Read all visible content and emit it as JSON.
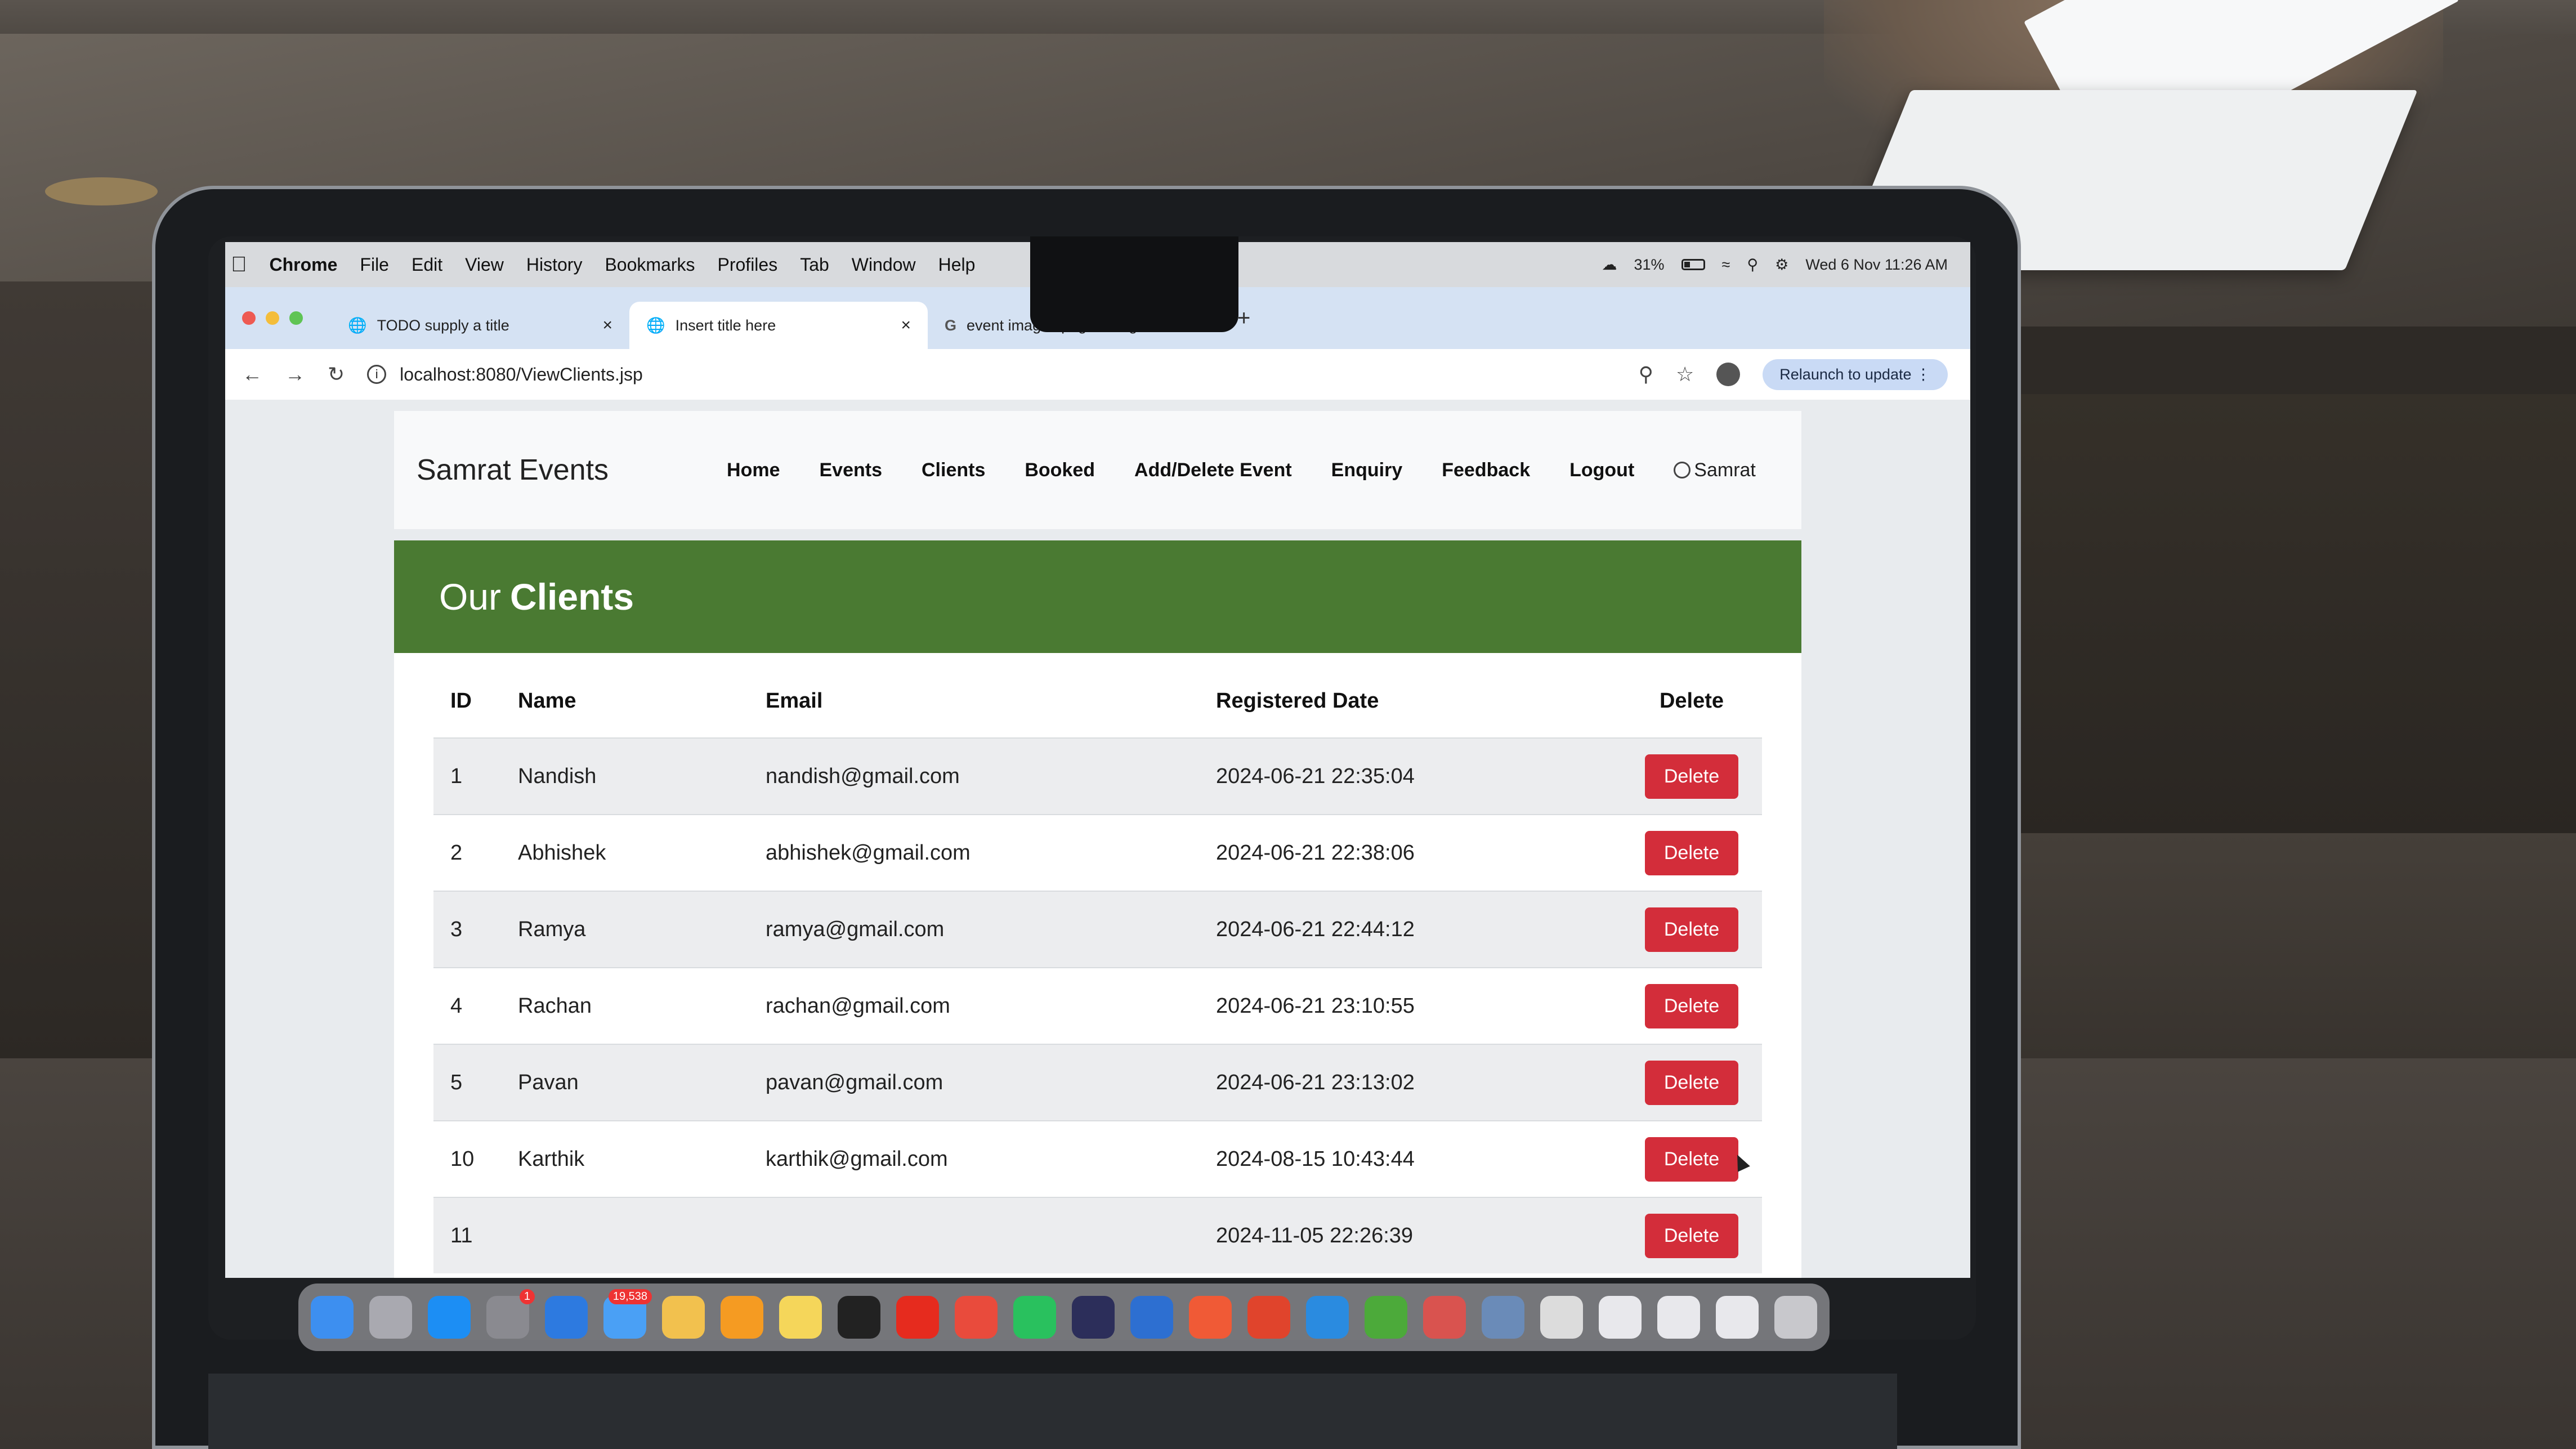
{
  "menubar": {
    "app": "Chrome",
    "items": [
      "File",
      "Edit",
      "View",
      "History",
      "Bookmarks",
      "Profiles",
      "Tab",
      "Window",
      "Help"
    ],
    "battery": "31%",
    "datetime": "Wed 6 Nov 11:26 AM"
  },
  "browser": {
    "tabs": [
      {
        "title": "TODO supply a title"
      },
      {
        "title": "Insert title here"
      },
      {
        "title": "event images png - Google S"
      }
    ],
    "url": "localhost:8080/ViewClients.jsp",
    "relaunch": "Relaunch to update"
  },
  "site": {
    "brand": "Samrat Events",
    "nav": [
      "Home",
      "Events",
      "Clients",
      "Booked",
      "Add/Delete Event",
      "Enquiry",
      "Feedback",
      "Logout"
    ],
    "user": "Samrat"
  },
  "banner": {
    "prefix": "Our",
    "title": "Clients"
  },
  "table": {
    "headers": {
      "id": "ID",
      "name": "Name",
      "email": "Email",
      "date": "Registered Date",
      "del": "Delete"
    },
    "rows": [
      {
        "id": "1",
        "name": "Nandish",
        "email": "nandish@gmail.com",
        "date": "2024-06-21 22:35:04",
        "action": "Delete"
      },
      {
        "id": "2",
        "name": "Abhishek",
        "email": "abhishek@gmail.com",
        "date": "2024-06-21 22:38:06",
        "action": "Delete"
      },
      {
        "id": "3",
        "name": "Ramya",
        "email": "ramya@gmail.com",
        "date": "2024-06-21 22:44:12",
        "action": "Delete"
      },
      {
        "id": "4",
        "name": "Rachan",
        "email": "rachan@gmail.com",
        "date": "2024-06-21 23:10:55",
        "action": "Delete"
      },
      {
        "id": "5",
        "name": "Pavan",
        "email": "pavan@gmail.com",
        "date": "2024-06-21 23:13:02",
        "action": "Delete"
      },
      {
        "id": "10",
        "name": "Karthik",
        "email": "karthik@gmail.com",
        "date": "2024-08-15 10:43:44",
        "action": "Delete"
      },
      {
        "id": "11",
        "name": "",
        "email": "",
        "date": "2024-11-05 22:26:39",
        "action": "Delete"
      }
    ]
  },
  "dock": {
    "mail_badge": "19,538",
    "settings_badge": "1",
    "apps": [
      {
        "icon": "finder-icon",
        "color": "#3d8ff0"
      },
      {
        "icon": "launchpad-icon",
        "color": "#a9a9b0"
      },
      {
        "icon": "app-store-icon",
        "color": "#1c8ef4"
      },
      {
        "icon": "system-settings-icon",
        "color": "#8a8a90"
      },
      {
        "icon": "keynote-icon",
        "color": "#2d7ae0"
      },
      {
        "icon": "mail-icon",
        "color": "#4aa0f5"
      },
      {
        "icon": "photos-icon",
        "color": "#f2c14e"
      },
      {
        "icon": "pages-icon",
        "color": "#f59b22"
      },
      {
        "icon": "notes-icon",
        "color": "#f5d65a"
      },
      {
        "icon": "terminal-icon",
        "color": "#222"
      },
      {
        "icon": "youtube-icon",
        "color": "#e62b1e"
      },
      {
        "icon": "chrome-icon",
        "color": "#e94b3c"
      },
      {
        "icon": "whatsapp-icon",
        "color": "#29c15e"
      },
      {
        "icon": "eclipse-icon",
        "color": "#2c2e5a"
      },
      {
        "icon": "quicktime-icon",
        "color": "#2d6fd1"
      },
      {
        "icon": "pen-icon",
        "color": "#f05a36"
      },
      {
        "icon": "git-icon",
        "color": "#e0442c"
      },
      {
        "icon": "vscode-icon",
        "color": "#2a8be0"
      },
      {
        "icon": "spring-icon",
        "color": "#4caa3a"
      },
      {
        "icon": "box-icon",
        "color": "#d9534f"
      },
      {
        "icon": "preview-icon",
        "color": "#6a8bb8"
      },
      {
        "icon": "script-icon",
        "color": "#dcdcdc"
      },
      {
        "icon": "folder-icon",
        "color": "#e8e8ec"
      },
      {
        "icon": "folder-icon",
        "color": "#e8e8ec"
      },
      {
        "icon": "folder-icon",
        "color": "#e8e8ec"
      },
      {
        "icon": "trash-icon",
        "color": "#c8c8cc"
      }
    ]
  },
  "colors": {
    "banner": "#4a7a32",
    "delete_button": "#d32d3a",
    "tabstrip": "#d5e2f3"
  }
}
